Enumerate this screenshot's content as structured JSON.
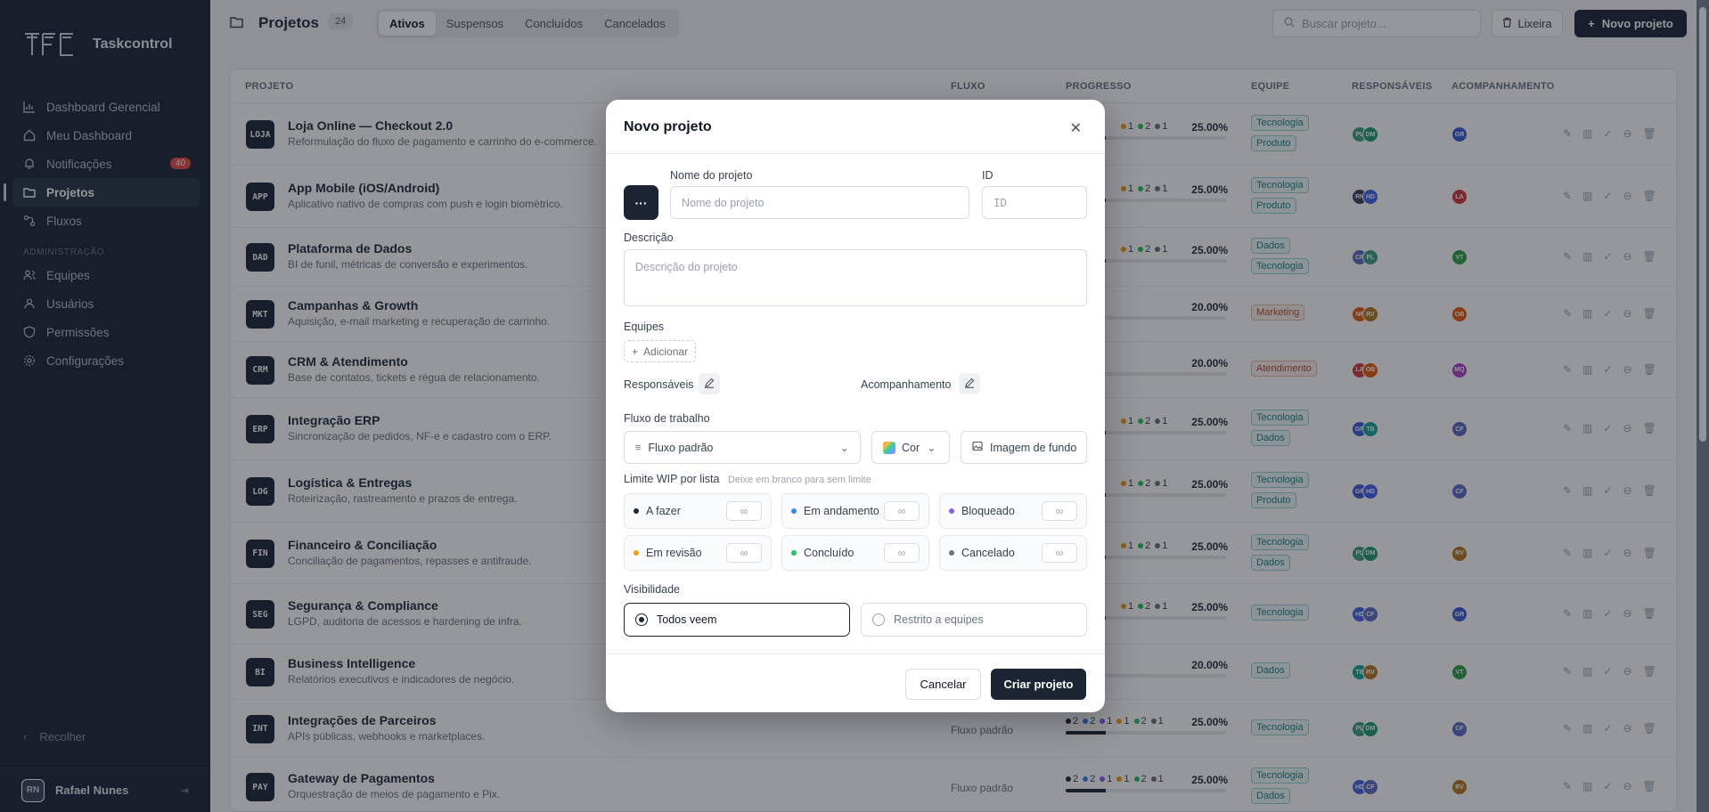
{
  "app": {
    "name": "Taskcontrol"
  },
  "sidebar": {
    "items": [
      {
        "label": "Dashboard Gerencial",
        "icon": "chart-icon"
      },
      {
        "label": "Meu Dashboard",
        "icon": "home-icon"
      },
      {
        "label": "Notificações",
        "icon": "bell-icon",
        "badge": "40"
      },
      {
        "label": "Projetos",
        "icon": "folder-icon",
        "active": true
      },
      {
        "label": "Fluxos",
        "icon": "flow-icon"
      }
    ],
    "admin_section": "ADMINISTRAÇÃO",
    "admin_items": [
      {
        "label": "Equipes",
        "icon": "users-icon"
      },
      {
        "label": "Usuários",
        "icon": "user-icon"
      },
      {
        "label": "Permissões",
        "icon": "shield-icon"
      },
      {
        "label": "Configurações",
        "icon": "gear-icon"
      }
    ],
    "collapse_label": "Recolher",
    "user": {
      "initials": "RN",
      "name": "Rafael Nunes"
    }
  },
  "header": {
    "title": "Projetos",
    "count": "24",
    "tabs": [
      "Ativos",
      "Suspensos",
      "Concluídos",
      "Cancelados"
    ],
    "active_tab": "Ativos",
    "search_placeholder": "Buscar projeto...",
    "trash_label": "Lixeira",
    "new_label": "Novo projeto"
  },
  "table": {
    "columns": {
      "project": "PROJETO",
      "flow": "FLUXO",
      "progress": "PROGRESSO",
      "team": "EQUIPE",
      "owners": "RESPONSÁVEIS",
      "followers": "ACOMPANHAMENTO"
    },
    "rows": [
      {
        "code": "LOJA",
        "name": "Loja Online — Checkout 2.0",
        "desc": "Reformulação do fluxo de pagamento e carrinho do e-commerce.",
        "flow": "",
        "counts": [
          "1",
          "2",
          "1"
        ],
        "pct": "25.00%",
        "progress": 0.25,
        "teams": [
          "Tecnologia",
          "Produto"
        ],
        "owners": [
          [
            "PL",
            "#3aa17e"
          ],
          [
            "DM",
            "#1f9d6b"
          ]
        ],
        "follower": [
          "GR",
          "#3b5bdb"
        ]
      },
      {
        "code": "APP",
        "name": "App Mobile (iOS/Android)",
        "desc": "Aplicativo nativo de compras com push e login biométrico.",
        "flow": "",
        "counts": [
          "1",
          "2",
          "1"
        ],
        "pct": "25.00%",
        "progress": 0.25,
        "teams": [
          "Tecnologia",
          "Produto"
        ],
        "owners": [
          [
            "RN",
            "#3a4256"
          ],
          [
            "HD",
            "#4263eb"
          ]
        ],
        "follower": [
          "LA",
          "#d63b3b"
        ]
      },
      {
        "code": "DAD",
        "name": "Plataforma de Dados",
        "desc": "BI de funil, métricas de conversão e experimentos.",
        "flow": "",
        "counts": [
          "1",
          "2",
          "1"
        ],
        "pct": "25.00%",
        "progress": 0.25,
        "teams": [
          "Dados",
          "Tecnologia"
        ],
        "owners": [
          [
            "CR",
            "#5c6ac4"
          ],
          [
            "PL",
            "#3aa17e"
          ]
        ],
        "follower": [
          "VT",
          "#2f9e44"
        ]
      },
      {
        "code": "MKT",
        "name": "Campanhas & Growth",
        "desc": "Aquisição, e-mail marketing e recuperação de carrinho.",
        "flow": "",
        "counts": [],
        "pct": "20.00%",
        "progress": 0.2,
        "teams": [
          "Marketing"
        ],
        "owners": [
          [
            "NF",
            "#e8590c"
          ],
          [
            "RV",
            "#b7791f"
          ]
        ],
        "follower": [
          "OB",
          "#e8590c"
        ]
      },
      {
        "code": "CRM",
        "name": "CRM & Atendimento",
        "desc": "Base de contatos, tickets e régua de relacionamento.",
        "flow": "",
        "counts": [],
        "pct": "20.00%",
        "progress": 0.2,
        "teams": [
          "Atendimento"
        ],
        "owners": [
          [
            "LA",
            "#d63b3b"
          ],
          [
            "OB",
            "#e8590c"
          ]
        ],
        "follower": [
          "MQ",
          "#ae3ec9"
        ]
      },
      {
        "code": "ERP",
        "name": "Integração ERP",
        "desc": "Sincronização de pedidos, NF-e e cadastro com o ERP.",
        "flow": "",
        "counts": [
          "1",
          "2",
          "1"
        ],
        "pct": "25.00%",
        "progress": 0.25,
        "teams": [
          "Tecnologia",
          "Dados"
        ],
        "owners": [
          [
            "GR",
            "#3b5bdb"
          ],
          [
            "TB",
            "#12a594"
          ]
        ],
        "follower": [
          "CF",
          "#5c6ac4"
        ]
      },
      {
        "code": "LOG",
        "name": "Logística & Entregas",
        "desc": "Roteirização, rastreamento e prazos de entrega.",
        "flow": "",
        "counts": [
          "1",
          "2",
          "1"
        ],
        "pct": "25.00%",
        "progress": 0.25,
        "teams": [
          "Tecnologia",
          "Produto"
        ],
        "owners": [
          [
            "GR",
            "#3b5bdb"
          ],
          [
            "HD",
            "#4263eb"
          ]
        ],
        "follower": [
          "CF",
          "#5c6ac4"
        ]
      },
      {
        "code": "FIN",
        "name": "Financeiro & Conciliação",
        "desc": "Conciliação de pagamentos, repasses e antifraude.",
        "flow": "",
        "counts": [
          "1",
          "2",
          "1"
        ],
        "pct": "25.00%",
        "progress": 0.25,
        "teams": [
          "Tecnologia",
          "Dados"
        ],
        "owners": [
          [
            "PL",
            "#3aa17e"
          ],
          [
            "DM",
            "#1f9d6b"
          ]
        ],
        "follower": [
          "RV",
          "#b7791f"
        ]
      },
      {
        "code": "SEG",
        "name": "Segurança & Compliance",
        "desc": "LGPD, auditoria de acessos e hardening de infra.",
        "flow": "",
        "counts": [
          "1",
          "2",
          "1"
        ],
        "pct": "25.00%",
        "progress": 0.25,
        "teams": [
          "Tecnologia"
        ],
        "owners": [
          [
            "HD",
            "#4263eb"
          ],
          [
            "CF",
            "#5c6ac4"
          ]
        ],
        "follower": [
          "GR",
          "#3b5bdb"
        ]
      },
      {
        "code": "BI",
        "name": "Business Intelligence",
        "desc": "Relatórios executivos e indicadores de negócio.",
        "flow": "",
        "counts": [],
        "pct": "20.00%",
        "progress": 0.2,
        "teams": [
          "Dados"
        ],
        "owners": [
          [
            "TB",
            "#12a594"
          ],
          [
            "RV",
            "#b7791f"
          ]
        ],
        "follower": [
          "VT",
          "#2f9e44"
        ]
      },
      {
        "code": "INT",
        "name": "Integrações de Parceiros",
        "desc": "APIs públicas, webhooks e marketplaces.",
        "flow": "Fluxo padrão",
        "counts": [
          "2",
          "2",
          "1",
          "1",
          "2",
          "1"
        ],
        "pct": "25.00%",
        "progress": 0.25,
        "teams": [
          "Tecnologia"
        ],
        "owners": [
          [
            "PL",
            "#3aa17e"
          ],
          [
            "DM",
            "#1f9d6b"
          ]
        ],
        "follower": [
          "CF",
          "#5c6ac4"
        ]
      },
      {
        "code": "PAY",
        "name": "Gateway de Pagamentos",
        "desc": "Orquestração de meios de pagamento e Pix.",
        "flow": "Fluxo padrão",
        "counts": [
          "2",
          "2",
          "1",
          "1",
          "2",
          "1"
        ],
        "pct": "25.00%",
        "progress": 0.25,
        "teams": [
          "Tecnologia",
          "Dados"
        ],
        "owners": [
          [
            "HD",
            "#4263eb"
          ],
          [
            "CF",
            "#5c6ac4"
          ]
        ],
        "follower": [
          "RV",
          "#b7791f"
        ]
      }
    ]
  },
  "modal": {
    "title": "Novo projeto",
    "name_label": "Nome do projeto",
    "name_placeholder": "Nome do projeto",
    "id_label": "ID",
    "id_placeholder": "ID",
    "desc_label": "Descrição",
    "desc_placeholder": "Descrição do projeto",
    "teams_label": "Equipes",
    "add_label": "Adicionar",
    "owners_label": "Responsáveis",
    "followers_label": "Acompanhamento",
    "flow_label": "Fluxo de trabalho",
    "flow_value": "Fluxo padrão",
    "color_label": "Cor",
    "bg_label": "Imagem de fundo",
    "wip_label": "Limite WIP por lista",
    "wip_hint": "Deixe em branco para sem limite",
    "wip": [
      {
        "label": "A fazer",
        "color": "#1f2937"
      },
      {
        "label": "Em andamento",
        "color": "#3b82f6"
      },
      {
        "label": "Bloqueado",
        "color": "#8b5cf6"
      },
      {
        "label": "Em revisão",
        "color": "#f59e0b"
      },
      {
        "label": "Concluído",
        "color": "#22c55e"
      },
      {
        "label": "Cancelado",
        "color": "#6b7280"
      }
    ],
    "wip_placeholder": "∞",
    "visibility_label": "Visibilidade",
    "vis_all": "Todos veem",
    "vis_restricted": "Restrito a equipes",
    "cancel_label": "Cancelar",
    "create_label": "Criar projeto"
  }
}
